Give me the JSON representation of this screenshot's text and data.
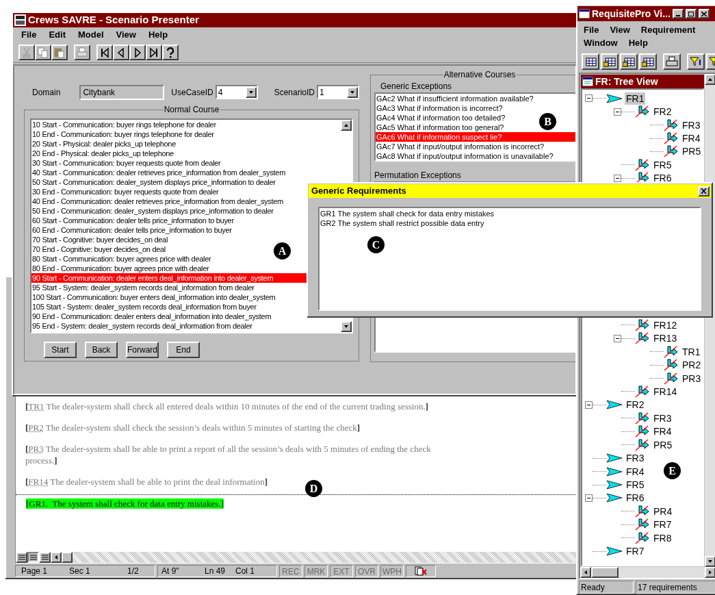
{
  "savre_window": {
    "title": "Crews SAVRE - Scenario Presenter",
    "menu": [
      "File",
      "Edit",
      "Model",
      "View",
      "Help"
    ],
    "toolbar": [
      {
        "kind": "cut",
        "disabled": true
      },
      {
        "kind": "copy",
        "disabled": true
      },
      {
        "kind": "paste",
        "disabled": true
      },
      {
        "kind": "print",
        "disabled": true
      },
      {
        "kind": "first",
        "disabled": false
      },
      {
        "kind": "previous",
        "disabled": false
      },
      {
        "kind": "next",
        "disabled": false
      },
      {
        "kind": "last",
        "disabled": false
      },
      {
        "kind": "help",
        "disabled": false
      }
    ],
    "domain": {
      "label": "Domain",
      "value": "Citybank"
    },
    "use_case_id": {
      "label": "UseCaseID",
      "value": "4"
    },
    "scenario_id": {
      "label": "ScenarioID",
      "value": "1"
    },
    "normal_course": {
      "title": "Normal Course",
      "rows": [
        {
          "text": "10 Start - Communication: buyer rings telephone for dealer",
          "selected": false
        },
        {
          "text": "10 End - Communication: buyer rings telephone for dealer",
          "selected": false
        },
        {
          "text": "20 Start - Physical: dealer picks_up telephone",
          "selected": false
        },
        {
          "text": "20 End - Physical: dealer picks_up telephone",
          "selected": false
        },
        {
          "text": "30 Start - Communication: buyer requests quote from dealer",
          "selected": false
        },
        {
          "text": "40 Start - Communication: dealer retrieves price_information from dealer_system",
          "selected": false
        },
        {
          "text": "50 Start - Communication: dealer_system displays price_information to dealer",
          "selected": false
        },
        {
          "text": "30 End - Communication: buyer requests quote from dealer",
          "selected": false
        },
        {
          "text": "40 End - Communication: dealer retrieves price_information from dealer_system",
          "selected": false
        },
        {
          "text": "50 End - Communication: dealer_system displays price_information to dealer",
          "selected": false
        },
        {
          "text": "60 Start - Communication: dealer tells price_information to buyer",
          "selected": false
        },
        {
          "text": "60 End - Communication: dealer tells price_information to buyer",
          "selected": false
        },
        {
          "text": "70 Start - Cognitive: buyer decides_on deal",
          "selected": false
        },
        {
          "text": "70 End - Cognitive: buyer decides_on deal",
          "selected": false
        },
        {
          "text": "80 Start - Communication: buyer agrees price with dealer",
          "selected": false
        },
        {
          "text": "80 End - Communication: buyer agrees price with dealer",
          "selected": false
        },
        {
          "text": "90 Start - Communication: dealer enters deal_information into dealer_system",
          "selected": true
        },
        {
          "text": "95 Start - System: dealer_system records deal_information from dealer",
          "selected": false
        },
        {
          "text": "100 Start - Communication: buyer enters deal_information into dealer_system",
          "selected": false
        },
        {
          "text": "105 Start - System: dealer_system records deal_information from buyer",
          "selected": false
        },
        {
          "text": "90 End - Communication: dealer enters deal_information into dealer_system",
          "selected": false
        },
        {
          "text": "95 End - System: dealer_system records deal_information from dealer",
          "selected": false
        }
      ],
      "buttons": [
        "Start",
        "Back",
        "Forward",
        "End"
      ]
    },
    "alternative_courses": {
      "title": "Alternative Courses",
      "generic_exceptions": {
        "label": "Generic Exceptions",
        "rows": [
          {
            "text": "GAc2 What if insufficient information available?",
            "selected": false
          },
          {
            "text": "GAc3 What if information is incorrect?",
            "selected": false
          },
          {
            "text": "GAc4 What if information too detailed?",
            "selected": false
          },
          {
            "text": "GAc5 What if information too general?",
            "selected": false
          },
          {
            "text": "GAc6 What if information suspect lie?",
            "selected": true
          },
          {
            "text": "GAc7 What if input/output information is incorrect?",
            "selected": false
          },
          {
            "text": "GAc8 What if input/output information is unavailable?",
            "selected": false
          }
        ]
      },
      "permutation_exceptions": {
        "label": "Permutation Exceptions"
      }
    }
  },
  "generic_requirements_dialog": {
    "title": "Generic Requirements",
    "rows": [
      "GR1 The system shall check for data entry mistakes",
      "GR2 The system shall restrict possible data entry"
    ]
  },
  "word_document": {
    "paragraphs": [
      {
        "open": "[",
        "tag": "TR1",
        "text": " The dealer-system shall check all entered deals within 10 minutes of the end of the current trading session.",
        "close": "]"
      },
      {
        "open": "[",
        "tag": "PR2",
        "text": " The dealer-system shall check the session’s deals within 5 minutes of starting the check",
        "close": "]"
      },
      {
        "open": "[",
        "tag": "PR3",
        "text": " The dealer-system shall be able to print a report of all the session’s deals with 5 minutes of ending the check process.",
        "close": "]"
      },
      {
        "open": "[",
        "tag": "FR14",
        "text": " The dealer-system shall be able to print the deal information",
        "close": "]"
      }
    ],
    "highlight": "[GR1.  The system shall check for data entry mistakes.]",
    "status_bar": {
      "page": "Page 1",
      "section": "Sec 1",
      "pages": "1/2",
      "at": "At 9\"",
      "line": "Ln 49",
      "column": "Col 1",
      "indicators": [
        {
          "label": "REC",
          "on": false
        },
        {
          "label": "MRK",
          "on": false
        },
        {
          "label": "EXT",
          "on": false
        },
        {
          "label": "OVR",
          "on": false
        },
        {
          "label": "WPH",
          "on": false
        }
      ]
    }
  },
  "requisitepro_window": {
    "title": "RequisitePro Vi...",
    "menu": [
      "File",
      "View",
      "Requirement",
      "Window",
      "Help"
    ],
    "tree_view": {
      "title": "FR: Tree View",
      "nodes": [
        {
          "label": "FR1",
          "selected": true,
          "suspect": false,
          "expanded": true,
          "children": [
            {
              "label": "FR2",
              "selected": false,
              "suspect": true,
              "expanded": true,
              "children": [
                {
                  "label": "FR3",
                  "selected": false,
                  "suspect": true
                },
                {
                  "label": "FR4",
                  "selected": false,
                  "suspect": true
                },
                {
                  "label": "PR5",
                  "selected": false,
                  "suspect": true
                }
              ]
            },
            {
              "label": "FR5",
              "selected": false,
              "suspect": true
            },
            {
              "label": "FR6",
              "selected": false,
              "suspect": true,
              "expanded": true
            },
            {
              "label": "FR12",
              "selected": false,
              "suspect": true
            },
            {
              "label": "FR13",
              "selected": false,
              "suspect": true,
              "expanded": true,
              "children": [
                {
                  "label": "TR1",
                  "selected": false,
                  "suspect": true
                },
                {
                  "label": "PR2",
                  "selected": false,
                  "suspect": true
                },
                {
                  "label": "PR3",
                  "selected": false,
                  "suspect": true
                }
              ]
            },
            {
              "label": "FR14",
              "selected": false,
              "suspect": true
            }
          ]
        },
        {
          "label": "FR2",
          "selected": false,
          "suspect": false,
          "expanded": true,
          "children": [
            {
              "label": "FR3",
              "selected": false,
              "suspect": true
            },
            {
              "label": "FR4",
              "selected": false,
              "suspect": true
            },
            {
              "label": "PR5",
              "selected": false,
              "suspect": true
            }
          ]
        },
        {
          "label": "FR3",
          "selected": false,
          "suspect": false
        },
        {
          "label": "FR4",
          "selected": false,
          "suspect": false
        },
        {
          "label": "FR5",
          "selected": false,
          "suspect": false
        },
        {
          "label": "FR6",
          "selected": false,
          "suspect": false,
          "expanded": true,
          "children": [
            {
              "label": "PR4",
              "selected": false,
              "suspect": true
            },
            {
              "label": "FR7",
              "selected": false,
              "suspect": true
            },
            {
              "label": "FR8",
              "selected": false,
              "suspect": true
            }
          ]
        },
        {
          "label": "FR7",
          "selected": false,
          "suspect": false
        }
      ]
    },
    "status_bar": [
      "Ready",
      "17 requirements"
    ]
  },
  "callouts": [
    "A",
    "B",
    "C",
    "D",
    "E"
  ]
}
